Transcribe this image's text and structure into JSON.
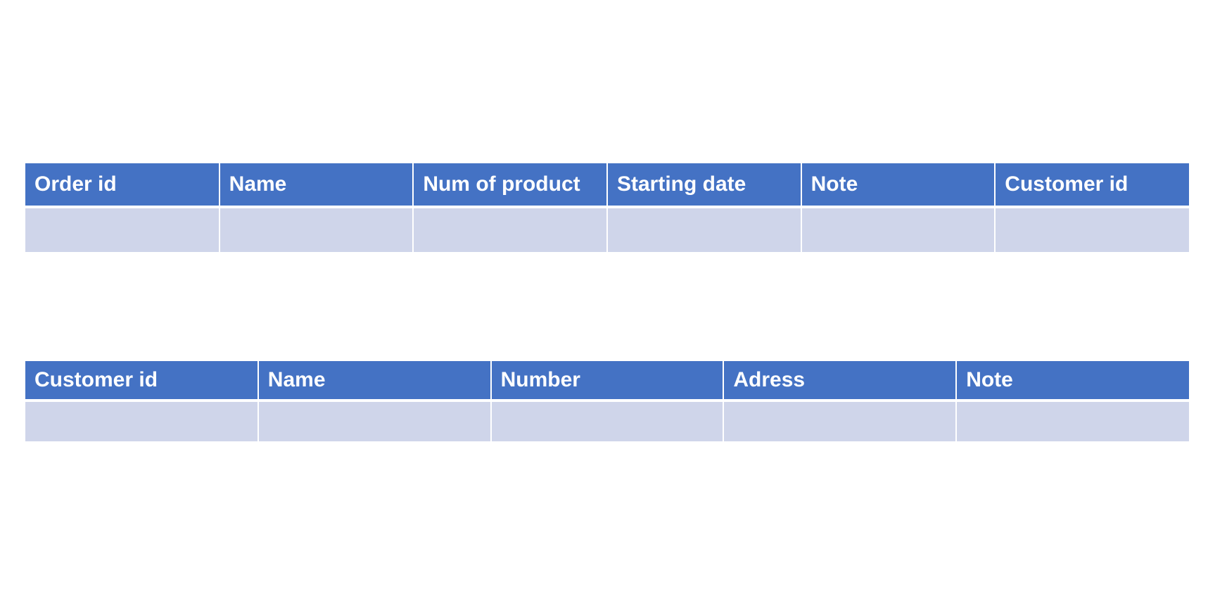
{
  "orders_table": {
    "headers": [
      "Order id",
      "Name",
      "Num of product",
      "Starting date",
      "Note",
      "Customer id"
    ],
    "rows": [
      [
        "",
        "",
        "",
        "",
        "",
        ""
      ]
    ]
  },
  "customers_table": {
    "headers": [
      "Customer id",
      "Name",
      "Number",
      "Adress",
      "Note"
    ],
    "rows": [
      [
        "",
        "",
        "",
        "",
        ""
      ]
    ]
  },
  "colors": {
    "header_background": "#4472c4",
    "header_text": "#ffffff",
    "cell_background": "#cfd5ea",
    "grid_lines": "#ffffff"
  }
}
